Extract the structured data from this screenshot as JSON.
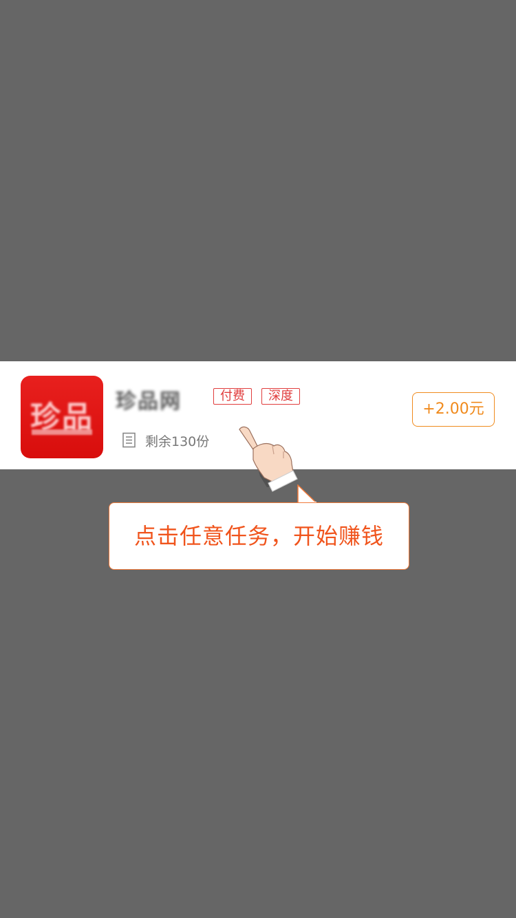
{
  "task": {
    "app_name": "珍品网",
    "icon_text": "珍品",
    "tags": [
      "付费",
      "深度"
    ],
    "remaining": "剩余130份",
    "reward": "+2.00元"
  },
  "guide": {
    "tip_text": "点击任意任务，开始赚钱"
  },
  "colors": {
    "backdrop": "#666666",
    "accent_orange": "#f08a1c",
    "tag_red": "#e03c3c",
    "tip_text": "#f0541c",
    "icon_red": "#e8201e"
  },
  "icons": {
    "doc": "document-icon",
    "hand": "pointing-hand-icon"
  }
}
